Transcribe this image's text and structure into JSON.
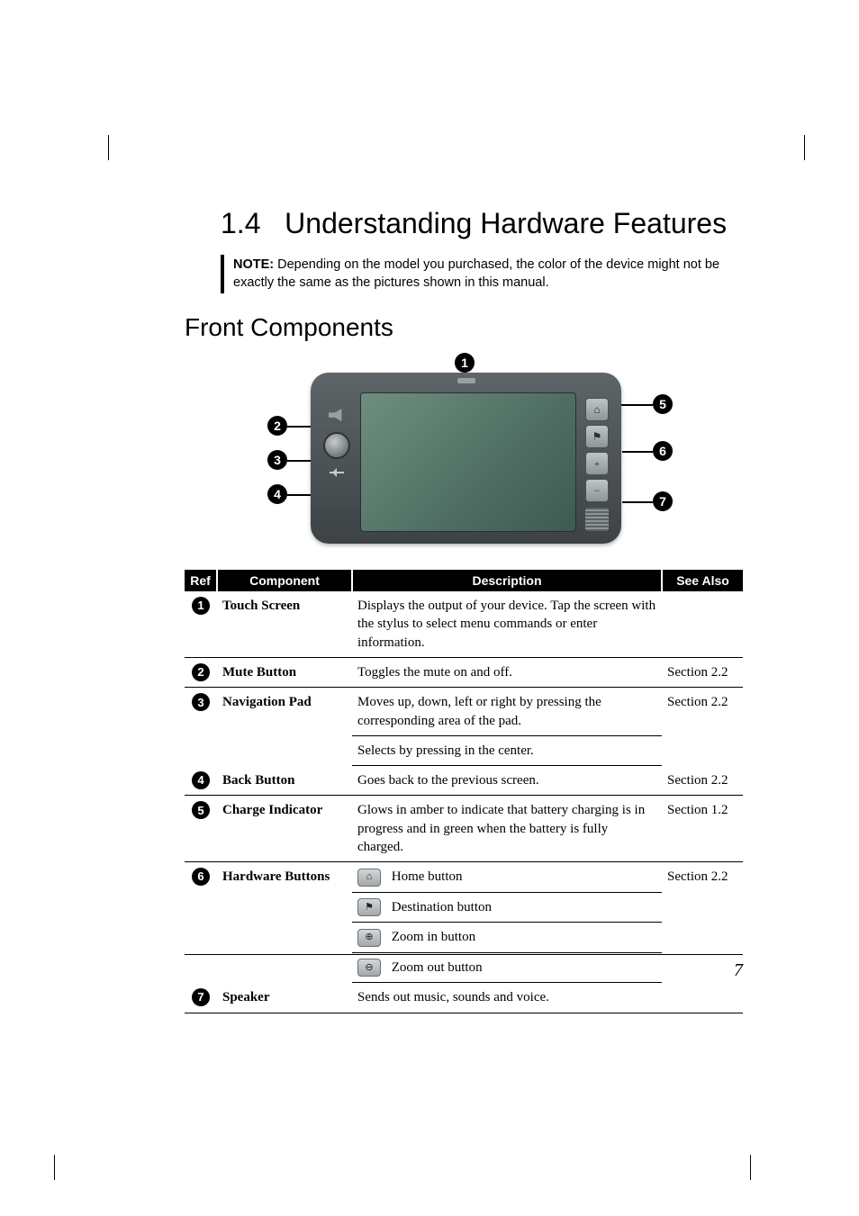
{
  "section": {
    "number": "1.4",
    "title": "Understanding Hardware Features"
  },
  "note": {
    "label": "NOTE:",
    "text": "Depending on the model you purchased, the color of the device might not be exactly the same as the pictures shown in this manual."
  },
  "subsection": "Front Components",
  "table": {
    "headers": {
      "ref": "Ref",
      "component": "Component",
      "description": "Description",
      "see_also": "See Also"
    },
    "rows": [
      {
        "ref": "1",
        "component": "Touch Screen",
        "descriptions": [
          "Displays the output of your device. Tap the screen with the stylus to select menu commands or enter information."
        ],
        "see_also": ""
      },
      {
        "ref": "2",
        "component": "Mute Button",
        "descriptions": [
          "Toggles the mute on and off."
        ],
        "see_also": "Section 2.2"
      },
      {
        "ref": "3",
        "component": "Navigation Pad",
        "descriptions": [
          "Moves up, down, left or right by pressing the corresponding area of the pad.",
          "Selects by pressing in the center."
        ],
        "see_also": "Section 2.2"
      },
      {
        "ref": "4",
        "component": "Back Button",
        "descriptions": [
          "Goes back to the previous screen."
        ],
        "see_also": "Section 2.2"
      },
      {
        "ref": "5",
        "component": "Charge Indicator",
        "descriptions": [
          "Glows in amber to indicate that battery charging is in progress and in green when the battery is fully charged."
        ],
        "see_also": "Section 1.2"
      },
      {
        "ref": "6",
        "component": "Hardware Buttons",
        "buttons": [
          {
            "icon": "⌂",
            "label": "Home button"
          },
          {
            "icon": "⚑",
            "label": "Destination button"
          },
          {
            "icon": "🔍+",
            "short": "⊕",
            "label": "Zoom in button"
          },
          {
            "icon": "🔍-",
            "short": "⊖",
            "label": "Zoom out button"
          }
        ],
        "see_also": "Section 2.2"
      },
      {
        "ref": "7",
        "component": "Speaker",
        "descriptions": [
          "Sends out music, sounds and voice."
        ],
        "see_also": ""
      }
    ]
  },
  "footer": {
    "page_number": "7"
  },
  "callouts": [
    "1",
    "2",
    "3",
    "4",
    "5",
    "6",
    "7"
  ]
}
